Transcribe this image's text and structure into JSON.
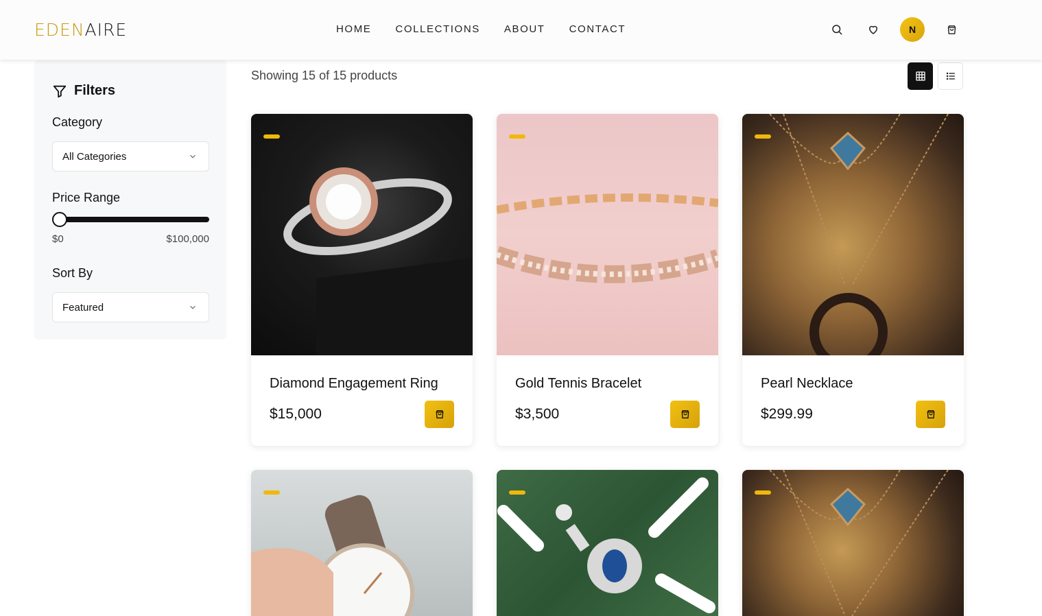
{
  "brand": {
    "part1": "EDEN",
    "part2": "AIRE"
  },
  "nav": [
    {
      "label": "HOME"
    },
    {
      "label": "COLLECTIONS"
    },
    {
      "label": "ABOUT"
    },
    {
      "label": "CONTACT"
    }
  ],
  "header_icons": {
    "search": "search-icon",
    "wishlist": "heart-icon",
    "avatar_initial": "N",
    "cart": "shopping-bag-icon"
  },
  "sidebar": {
    "title": "Filters",
    "category_label": "Category",
    "category_value": "All Categories",
    "price_label": "Price Range",
    "price_min": "$0",
    "price_max": "$100,000",
    "price_slider_fraction": 0,
    "sort_label": "Sort By",
    "sort_value": "Featured"
  },
  "results": {
    "text": "Showing 15 of 15 products"
  },
  "view_mode": "grid",
  "accent_color": "#f0b80c",
  "products": [
    {
      "name": "Diamond Engagement Ring",
      "price": "$15,000"
    },
    {
      "name": "Gold Tennis Bracelet",
      "price": "$3,500"
    },
    {
      "name": "Pearl Necklace",
      "price": "$299.99"
    },
    {
      "name": "",
      "price": ""
    },
    {
      "name": "",
      "price": ""
    },
    {
      "name": "",
      "price": ""
    }
  ]
}
